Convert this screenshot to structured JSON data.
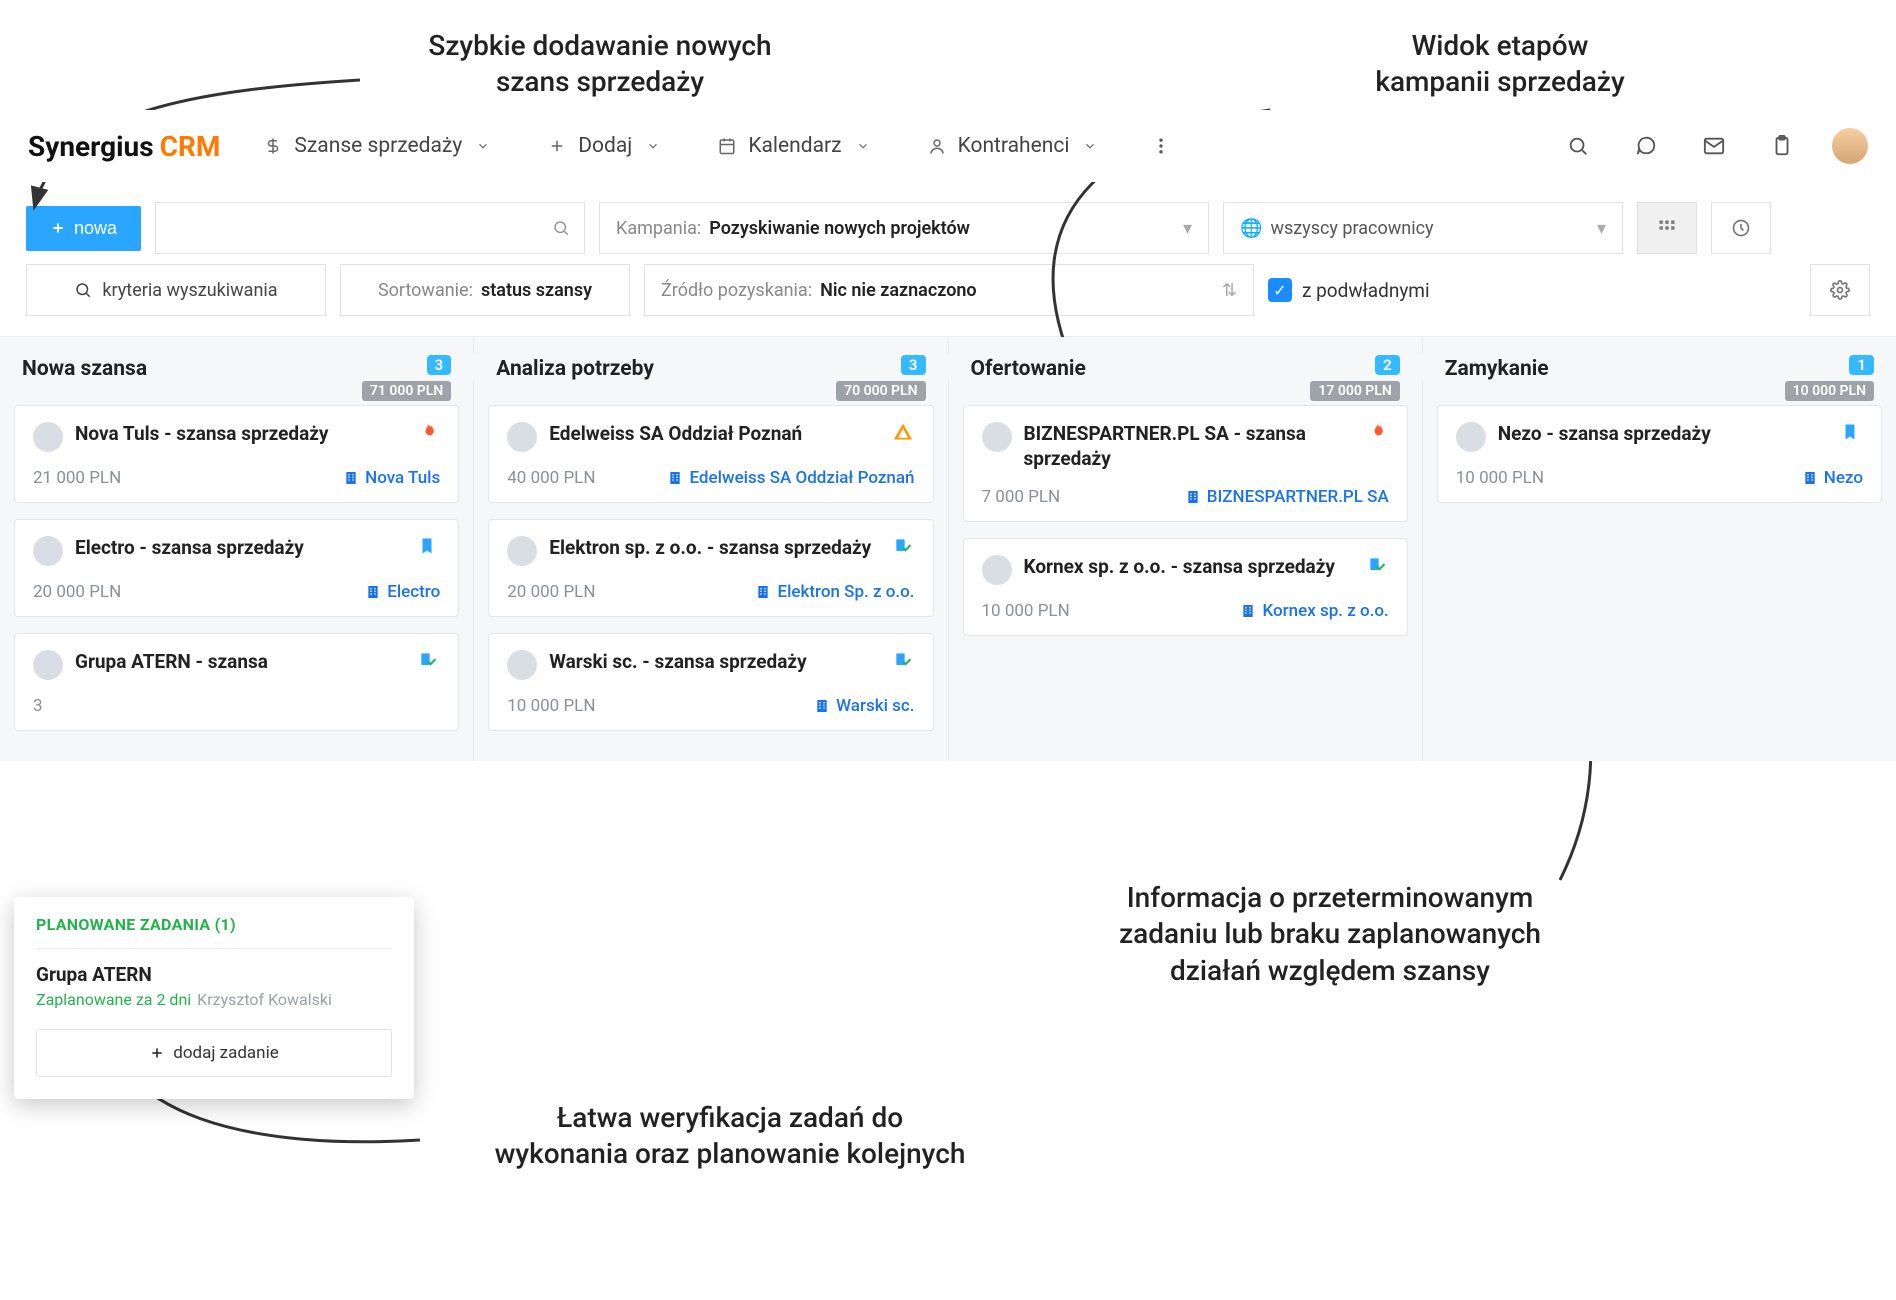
{
  "annotations": {
    "top_left": "Szybkie dodawanie nowych\nszans sprzedaży",
    "top_right": "Widok etapów\nkampanii sprzedaży",
    "right_mid": "Informacja o przeterminowanym\nzadaniu lub braku zaplanowanych\ndziałań względem szansy",
    "bottom": "Łatwa weryfikacja zadań do\nwykonania oraz planowanie kolejnych"
  },
  "logo": {
    "black": "Synergius",
    "orange": "CRM"
  },
  "nav": {
    "sales": "Szanse sprzedaży",
    "add": "Dodaj",
    "calendar": "Kalendarz",
    "contractors": "Kontrahenci"
  },
  "toolbar": {
    "new_button": "nowa",
    "search_placeholder": "",
    "campaign_label": "Kampania:",
    "campaign_value": "Pozyskiwanie nowych projektów",
    "employees_value": "wszyscy pracownicy",
    "criteria": "kryteria wyszukiwania",
    "sort_label": "Sortowanie:",
    "sort_value": "status szansy",
    "source_label": "Źródło pozyskania:",
    "source_value": "Nic nie zaznaczono",
    "subordinates": "z podwładnymi"
  },
  "columns": [
    {
      "title": "Nowa szansa",
      "count": "3",
      "sum": "71 000 PLN",
      "cards": [
        {
          "title": "Nova Tuls - szansa sprzedaży",
          "amount": "21 000 PLN",
          "company": "Nova Tuls",
          "flag": "flame"
        },
        {
          "title": "Electro - szansa sprzedaży",
          "amount": "20 000 PLN",
          "company": "Electro",
          "flag": "bookmark"
        },
        {
          "title": "Grupa ATERN - szansa",
          "amount": "3",
          "company": "",
          "flag": "task"
        }
      ]
    },
    {
      "title": "Analiza potrzeby",
      "count": "3",
      "sum": "70 000 PLN",
      "cards": [
        {
          "title": "Edelweiss SA Oddział Poznań",
          "amount": "40 000 PLN",
          "company": "Edelweiss SA Oddział Poznań",
          "flag": "warn"
        },
        {
          "title": "Elektron sp. z o.o. - szansa sprzedaży",
          "amount": "20 000 PLN",
          "company": "Elektron Sp. z o.o.",
          "flag": "task"
        },
        {
          "title": "Warski sc. - szansa sprzedaży",
          "amount": "10 000 PLN",
          "company": "Warski sc.",
          "flag": "task"
        }
      ]
    },
    {
      "title": "Ofertowanie",
      "count": "2",
      "sum": "17 000 PLN",
      "cards": [
        {
          "title": "BIZNESPARTNER.PL SA - szansa sprzedaży",
          "amount": "7 000 PLN",
          "company": "BIZNESPARTNER.PL SA",
          "flag": "flame"
        },
        {
          "title": "Kornex sp. z o.o. - szansa sprzedaży",
          "amount": "10 000 PLN",
          "company": "Kornex sp. z o.o.",
          "flag": "task"
        }
      ]
    },
    {
      "title": "Zamykanie",
      "count": "1",
      "sum": "10 000 PLN",
      "cards": [
        {
          "title": "Nezo - szansa sprzedaży",
          "amount": "10 000 PLN",
          "company": "Nezo",
          "flag": "bookmark"
        }
      ]
    }
  ],
  "popover": {
    "header": "PLANOWANE ZADANIA (1)",
    "title": "Grupa ATERN",
    "sub_green": "Zaplanowane za 2 dni",
    "sub_grey": "Krzysztof Kowalski",
    "add_task": "dodaj zadanie"
  }
}
